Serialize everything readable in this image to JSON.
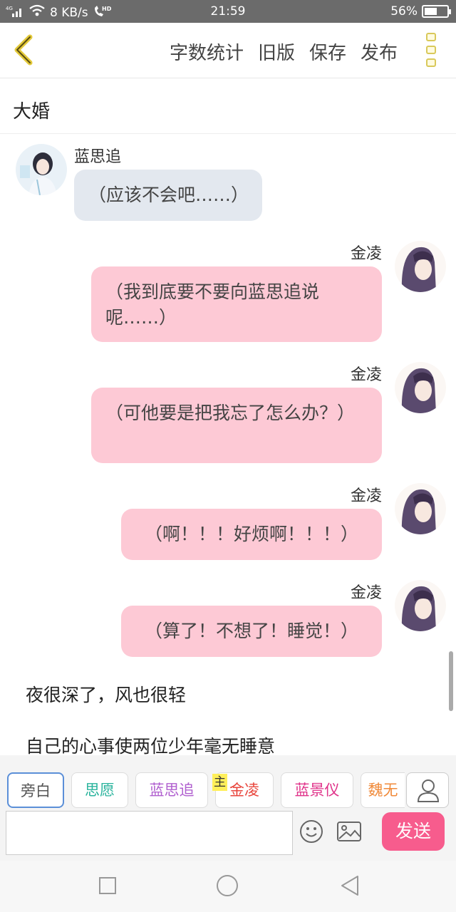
{
  "status_bar": {
    "network": "4G",
    "speed": "8 KB/s",
    "hd": "HD",
    "time": "21:59",
    "battery": "56%",
    "battery_level": 0.56
  },
  "toolbar": {
    "actions": [
      "字数统计",
      "旧版",
      "保存",
      "发布"
    ]
  },
  "chapter_title": "大婚",
  "messages": [
    {
      "speaker": "蓝思追",
      "side": "left",
      "text": "（应该不会吧……）"
    },
    {
      "speaker": "金凌",
      "side": "right",
      "text": "（我到底要不要向蓝思追说呢……）"
    },
    {
      "speaker": "金凌",
      "side": "right",
      "text": "（可他要是把我忘了怎么办？）"
    },
    {
      "speaker": "金凌",
      "side": "right",
      "text": "（啊！！！好烦啊！！！）"
    },
    {
      "speaker": "金凌",
      "side": "right",
      "text": "（算了！不想了！睡觉！）"
    }
  ],
  "narration": [
    "夜很深了，风也很轻",
    "自己的心事使两位少年毫无睡意"
  ],
  "roles": {
    "narrator": "旁白",
    "items": [
      {
        "label": "思愿",
        "color": "#29b39c"
      },
      {
        "label": "蓝思追",
        "color": "#b05fcf"
      },
      {
        "label": "金凌",
        "color": "#e8453c",
        "tag": "主"
      },
      {
        "label": "蓝景仪",
        "color": "#e0338a"
      },
      {
        "label": "魏无",
        "color": "#f08a3a"
      }
    ]
  },
  "composer": {
    "placeholder": "",
    "send_label": "发送"
  },
  "colors": {
    "accent_pink": "#f75c8d",
    "bubble_left": "#e3e8ef",
    "bubble_right": "#fdc9d5",
    "back_arrow": "#e3c93a"
  }
}
